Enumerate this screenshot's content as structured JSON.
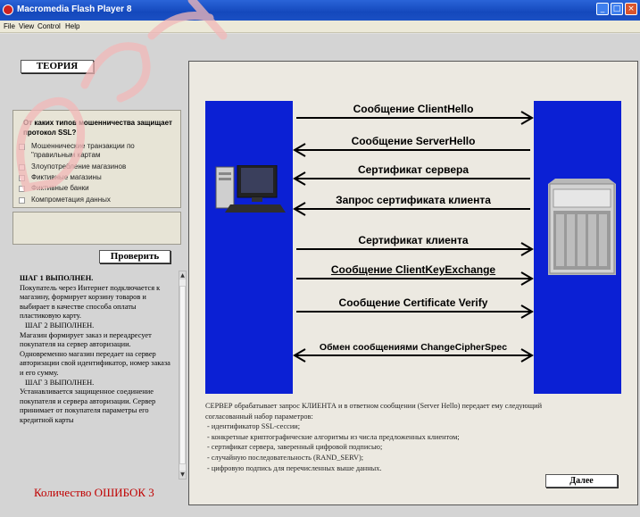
{
  "window": {
    "title": "Macromedia Flash Player 8",
    "controls": [
      "_",
      "□",
      "×"
    ]
  },
  "menu": [
    "File",
    "View",
    "Control",
    "Help"
  ],
  "theory_button": "ТЕОРИЯ",
  "quiz": {
    "question": "От каких типов мошенничества защищает протокол SSL?",
    "options": [
      "Мошеннические транзакции по \"правильным картам",
      "Злоупотребление магазинов",
      "Фиктивные магазины",
      "Фиктивные банки",
      "Компрометация данных"
    ]
  },
  "check_button": "Проверить",
  "steps": [
    {
      "type": "heading",
      "text": "ШАГ 1 ВЫПОЛНЕН."
    },
    {
      "type": "body",
      "text": "Покупатель через Интернет подключается к магазину, формирует корзину товаров и выбирает в качестве способа оплаты пластиковую карту."
    },
    {
      "type": "heading2",
      "text": "ШАГ 2 ВЫПОЛНЕН."
    },
    {
      "type": "body",
      "text": "Магазин формирует заказ и переадресует покупателя на сервер авторизации. Одновременно магазин передает на сервер авторизации свой идентификатор, номер заказа и его сумму."
    },
    {
      "type": "heading2",
      "text": "ШАГ 3 ВЫПОЛНЕН."
    },
    {
      "type": "body",
      "text": "Устанавливается защищенное соединение покупателя и сервера авторизации. Сервер принимает от покупателя параметры его кредитной карты"
    }
  ],
  "errors_label": "Количество ОШИБОК 3",
  "messages": [
    {
      "text": "Сообщение ClientHello",
      "direction": "right",
      "underline": false
    },
    {
      "text": "Сообщение ServerHello",
      "direction": "left",
      "underline": false
    },
    {
      "text": "Сертификат сервера",
      "direction": "left",
      "underline": false
    },
    {
      "text": "Запрос сертификата клиента",
      "direction": "left",
      "underline": false
    },
    {
      "text": "Сертификат клиента",
      "direction": "right",
      "underline": false
    },
    {
      "text": "Сообщение ClientKeyExchange",
      "direction": "right",
      "underline": true
    },
    {
      "text": "Сообщение Certificate Verify",
      "direction": "right",
      "underline": false
    },
    {
      "text": "Обмен сообщениями ChangeCipherSpec",
      "direction": "both",
      "underline": false
    }
  ],
  "description": {
    "intro": "СЕРВЕР обрабатывает запрос КЛИЕНТА и в ответном сообщении (Server Hello) передает ему следующий согласованный набор параметров:",
    "items": [
      "- идентификатор SSL-сессии;",
      "- конкретные криптографические алгоритмы из числа предложенных клиентом;",
      "- сертификат сервера, заверенный цифровой подписью;",
      "- случайную последовательность (RAND_SERV);",
      "- цифровую подпись для перечисленных выше данных."
    ]
  },
  "next_button": "Далее",
  "colors": {
    "pillar": "#0b20d4",
    "titlebar": "#1448bc",
    "error_text": "#c00000",
    "watermark": "#f2b8b8"
  }
}
